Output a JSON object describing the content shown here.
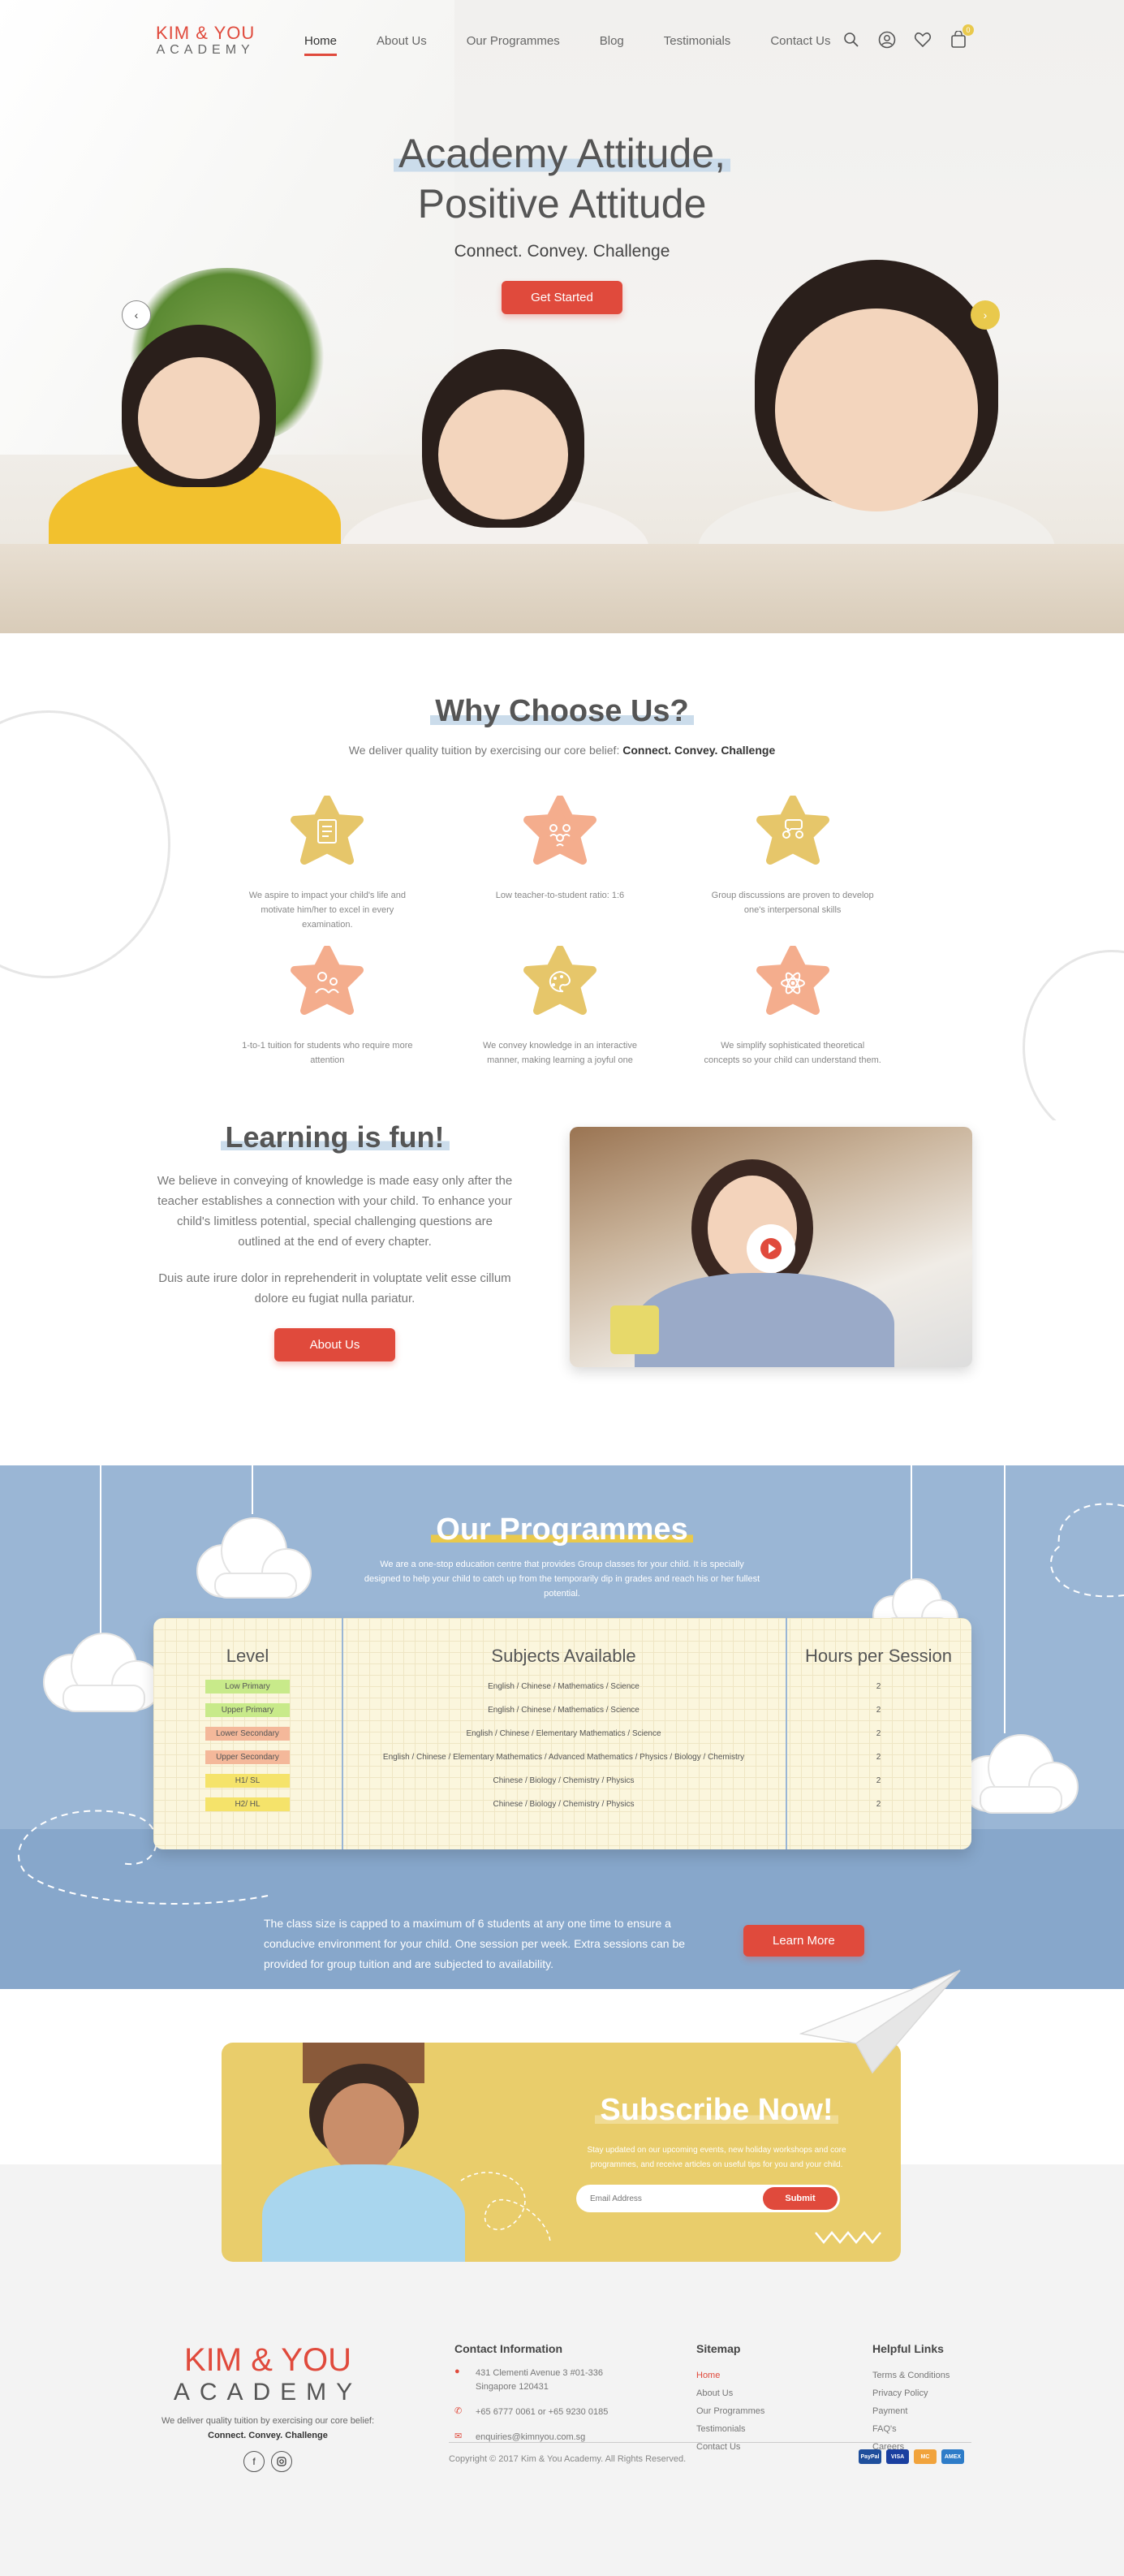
{
  "brand": {
    "logo_line1": "KIM & YOU",
    "logo_line2": "ACADEMY",
    "accent": "#e04a3c",
    "yellow": "#e9c94c",
    "blue": "#9ab6d5"
  },
  "nav": {
    "items": [
      "Home",
      "About Us",
      "Our Programmes",
      "Blog",
      "Testimonials",
      "Contact Us"
    ],
    "active": "Home",
    "icons": [
      "search-icon",
      "user-icon",
      "heart-icon",
      "cart-icon"
    ],
    "cart_count": "0"
  },
  "hero": {
    "title_line1": "Academy Attitude,",
    "title_line2": "Positive Attitude",
    "subtitle": "Connect. Convey. Challenge",
    "cta": "Get Started",
    "prev_icon": "chevron-left-icon",
    "next_icon": "chevron-right-icon"
  },
  "why": {
    "title": "Why Choose Us?",
    "intro": "We deliver quality tuition by exercising our core belief:",
    "intro_bold": "Connect. Convey. Challenge",
    "features": [
      {
        "icon": "clipboard-icon",
        "color": "#e6c66a",
        "text": "We aspire to impact your child's life and motivate him/her to excel in every examination."
      },
      {
        "icon": "group-icon",
        "color": "#f4ad8d",
        "text": "Low teacher-to-student ratio: 1:6"
      },
      {
        "icon": "discussion-icon",
        "color": "#e6c66a",
        "text": "Group discussions are proven to develop one's interpersonal skills"
      },
      {
        "icon": "one-to-one-icon",
        "color": "#f4ad8d",
        "text": "1-to-1 tuition for students who require more attention"
      },
      {
        "icon": "palette-icon",
        "color": "#e6c66a",
        "text": "We convey knowledge in an interactive manner, making learning a joyful one"
      },
      {
        "icon": "atom-icon",
        "color": "#f4ad8d",
        "text": "We simplify sophisticated theoretical concepts so your child can understand them."
      }
    ]
  },
  "learning": {
    "title": "Learning is fun!",
    "p1": "We believe in conveying of knowledge is made easy only after the teacher establishes a connection with your child. To enhance your child's limitless potential, special challenging questions are outlined at the end of every chapter.",
    "p2": "Duis aute irure dolor in reprehenderit in voluptate velit esse cillum dolore eu fugiat nulla pariatur.",
    "cta": "About Us",
    "video_icon": "play-icon"
  },
  "programmes": {
    "title": "Our Programmes",
    "intro": "We are a one-stop education centre that provides Group classes for your child. It is specially designed to help your child to catch up from the temporarily dip in grades and reach his or her fullest potential.",
    "headers": [
      "Level",
      "Subjects Available",
      "Hours per Session"
    ],
    "rows": [
      {
        "level": "Low Primary",
        "color": "#c8ea8a",
        "subjects": "English / Chinese / Mathematics / Science",
        "hours": "2"
      },
      {
        "level": "Upper Primary",
        "color": "#c8ea8a",
        "subjects": "English / Chinese / Mathematics / Science",
        "hours": "2"
      },
      {
        "level": "Lower Secondary",
        "color": "#f4b89a",
        "subjects": "English / Chinese / Elementary Mathematics / Science",
        "hours": "2"
      },
      {
        "level": "Upper Secondary",
        "color": "#f4b89a",
        "subjects": "English / Chinese / Elementary Mathematics / Advanced Mathematics / Physics / Biology / Chemistry",
        "hours": "2"
      },
      {
        "level": "H1/ SL",
        "color": "#f5e36a",
        "subjects": "Chinese / Biology / Chemistry / Physics",
        "hours": "2"
      },
      {
        "level": "H2/ HL",
        "color": "#f5e36a",
        "subjects": "Chinese / Biology / Chemistry / Physics",
        "hours": "2"
      }
    ],
    "note": "The class size is capped to a maximum of 6 students at any one time to ensure a conducive environment for your child. One session per week. Extra sessions can be provided for group tuition and are subjected to availability.",
    "cta": "Learn More"
  },
  "subscribe": {
    "title": "Subscribe Now!",
    "text": "Stay updated on our upcoming events, new holiday workshops and core programmes, and receive articles on useful tips for you and your child.",
    "placeholder": "Email Address",
    "button": "Submit"
  },
  "footer": {
    "tagline": "We deliver quality tuition by exercising our core belief:",
    "tagline_bold": "Connect. Convey. Challenge",
    "social": [
      "facebook-icon",
      "instagram-icon"
    ],
    "contact_title": "Contact Information",
    "address": "431 Clementi Avenue 3 #01-336 Singapore 120431",
    "phone": "+65 6777 0061 or +65 9230 0185",
    "email": "enquiries@kimnyou.com.sg",
    "sitemap_title": "Sitemap",
    "sitemap": [
      "Home",
      "About Us",
      "Our Programmes",
      "Testimonials",
      "Contact Us"
    ],
    "helpful_title": "Helpful Links",
    "helpful": [
      "Terms & Conditions",
      "Privacy Policy",
      "Payment",
      "FAQ's",
      "Careers"
    ],
    "copyright": "Copyright © 2017 Kim & You Academy. All Rights Reserved.",
    "payments": [
      "PayPal",
      "VISA",
      "MC",
      "AMEX"
    ]
  }
}
